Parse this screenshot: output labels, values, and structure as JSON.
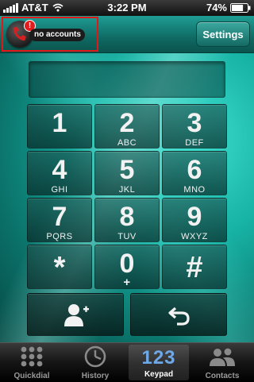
{
  "status_bar": {
    "carrier": "AT&T",
    "time": "3:22 PM",
    "battery": "74%",
    "battery_level": 0.74,
    "icons": [
      "signal-bars-icon",
      "wifi-icon",
      "battery-icon"
    ]
  },
  "header": {
    "account_status": "no accounts",
    "alert_symbol": "!",
    "settings_label": "Settings",
    "alert_color": "#e21d1d"
  },
  "dial_display": {
    "number": ""
  },
  "keys": [
    {
      "digit": "1",
      "letters": ""
    },
    {
      "digit": "2",
      "letters": "ABC"
    },
    {
      "digit": "3",
      "letters": "DEF"
    },
    {
      "digit": "4",
      "letters": "GHI"
    },
    {
      "digit": "5",
      "letters": "JKL"
    },
    {
      "digit": "6",
      "letters": "MNO"
    },
    {
      "digit": "7",
      "letters": "PQRS"
    },
    {
      "digit": "8",
      "letters": "TUV"
    },
    {
      "digit": "9",
      "letters": "WXYZ"
    },
    {
      "digit": "*",
      "letters": ""
    },
    {
      "digit": "0",
      "letters": "+"
    },
    {
      "digit": "#",
      "letters": ""
    }
  ],
  "actions": {
    "add_contact_icon": "add-contact-icon",
    "backspace_icon": "backspace-icon"
  },
  "tabs": [
    {
      "label": "Quickdial",
      "icon": "grid-icon",
      "active": false
    },
    {
      "label": "History",
      "icon": "clock-icon",
      "active": false
    },
    {
      "label": "Keypad",
      "icon_text": "123",
      "active": true
    },
    {
      "label": "Contacts",
      "icon": "contacts-icon",
      "active": false
    }
  ],
  "theme": {
    "accent": "#17b3a5",
    "header": "#0f6a63",
    "active_tab_icon": "#6fa8e6"
  }
}
